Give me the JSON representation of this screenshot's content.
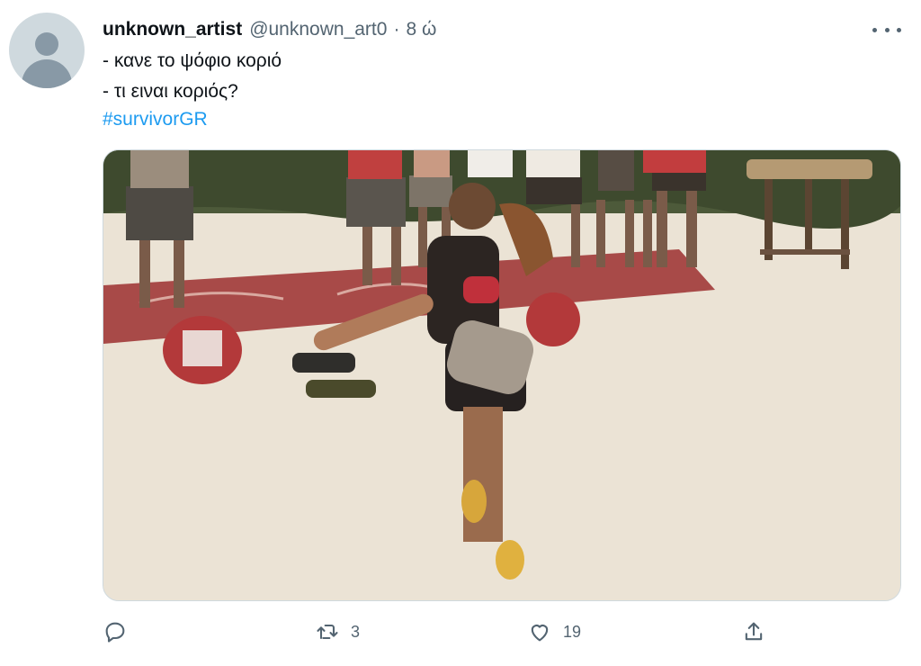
{
  "tweet": {
    "author_name": "unknown_artist",
    "author_handle": "@unknown_art0",
    "separator": "·",
    "time": "8 ώ",
    "lines": [
      "- κανε το ψόφιο κοριό",
      "- τι ειναι κοριός?"
    ],
    "hashtag": "#survivorGR"
  },
  "media": {
    "kind": "photo",
    "description_icon": "photo-image"
  },
  "actions": {
    "reply": {
      "icon": "reply-icon",
      "count": ""
    },
    "retweet": {
      "icon": "retweet-icon",
      "count": "3"
    },
    "like": {
      "icon": "heart-icon",
      "count": "19"
    },
    "share": {
      "icon": "share-icon",
      "count": ""
    }
  },
  "colors": {
    "link": "#1d9bf0",
    "secondary_text": "#536471",
    "border": "#cfd9de"
  }
}
